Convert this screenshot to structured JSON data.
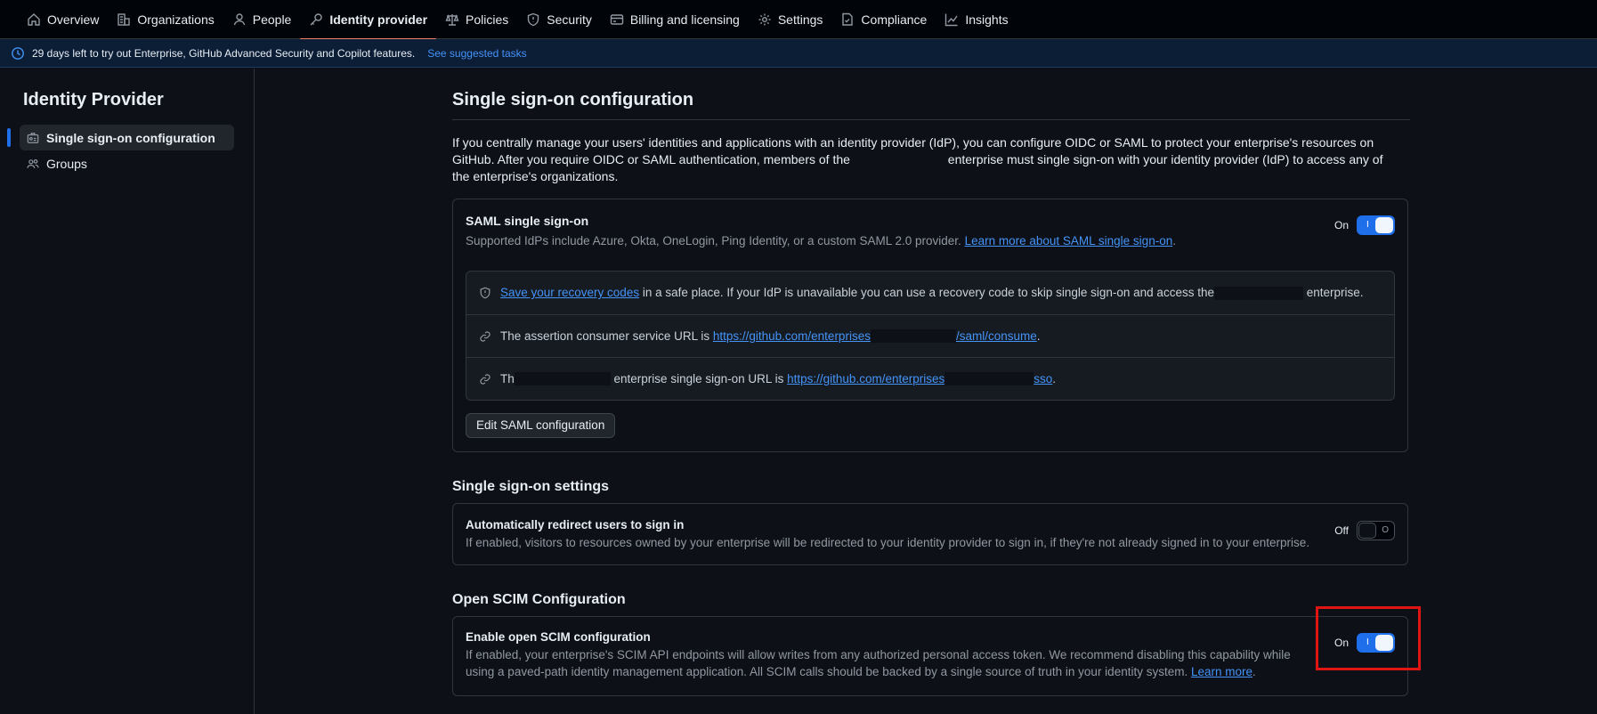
{
  "nav": {
    "items": [
      {
        "label": "Overview",
        "icon": "home-icon"
      },
      {
        "label": "Organizations",
        "icon": "organization-icon"
      },
      {
        "label": "People",
        "icon": "person-icon"
      },
      {
        "label": "Identity provider",
        "icon": "key-icon",
        "active": true
      },
      {
        "label": "Policies",
        "icon": "law-icon"
      },
      {
        "label": "Security",
        "icon": "shield-icon"
      },
      {
        "label": "Billing and licensing",
        "icon": "credit-card-icon"
      },
      {
        "label": "Settings",
        "icon": "gear-icon"
      },
      {
        "label": "Compliance",
        "icon": "checklist-icon"
      },
      {
        "label": "Insights",
        "icon": "graph-icon"
      }
    ]
  },
  "banner": {
    "text": "29 days left to try out Enterprise, GitHub Advanced Security and Copilot features.",
    "link": "See suggested tasks"
  },
  "sidebar": {
    "title": "Identity Provider",
    "items": [
      {
        "label": "Single sign-on configuration",
        "icon": "id-badge-icon",
        "active": true
      },
      {
        "label": "Groups",
        "icon": "people-icon"
      }
    ]
  },
  "main": {
    "title": "Single sign-on configuration",
    "intro_1": "If you centrally manage your users' identities and applications with an identity provider (IdP), you can configure OIDC or SAML to protect your enterprise's resources on GitHub. After you require OIDC or SAML authentication, members of the",
    "intro_2": "enterprise must single sign-on with your identity provider (IdP) to access any of the enterprise's organizations.",
    "saml": {
      "title": "SAML single sign-on",
      "desc": "Supported IdPs include Azure, Okta, OneLogin, Ping Identity, or a custom SAML 2.0 provider.",
      "learn_more": "Learn more about SAML single sign-on",
      "toggle_label": "On",
      "enabled": true,
      "rows": {
        "recovery_link": "Save your recovery codes",
        "recovery_text": "in a safe place. If your IdP is unavailable you can use a recovery code to skip single sign-on and access the",
        "recovery_suffix": "enterprise.",
        "acs_text": "The assertion consumer service URL is",
        "acs_link_a": "https://github.com/enterprises",
        "acs_link_b": "/saml/consume",
        "sso_prefix": "Th",
        "sso_text": "enterprise single sign-on URL is",
        "sso_link_a": "https://github.com/enterprises",
        "sso_link_b": "sso"
      },
      "edit_button": "Edit SAML configuration"
    },
    "sso_settings": {
      "title": "Single sign-on settings",
      "redirect_title": "Automatically redirect users to sign in",
      "redirect_desc": "If enabled, visitors to resources owned by your enterprise will be redirected to your identity provider to sign in, if they're not already signed in to your enterprise.",
      "toggle_label": "Off",
      "enabled": false
    },
    "scim": {
      "title": "Open SCIM Configuration",
      "enable_title": "Enable open SCIM configuration",
      "enable_desc_1": "If enabled, your enterprise's SCIM API endpoints will allow writes from any authorized personal access token. We recommend disabling this capability while using",
      "enable_desc_2": "a paved-path identity management application. All SCIM calls should be backed by a single source of truth in your identity system.",
      "learn_more": "Learn more",
      "toggle_label": "On",
      "enabled": true
    }
  },
  "colors": {
    "accent": "#1f6feb",
    "link": "#4493f8",
    "highlight": "#e11414",
    "nav_active_underline": "#f78166"
  }
}
